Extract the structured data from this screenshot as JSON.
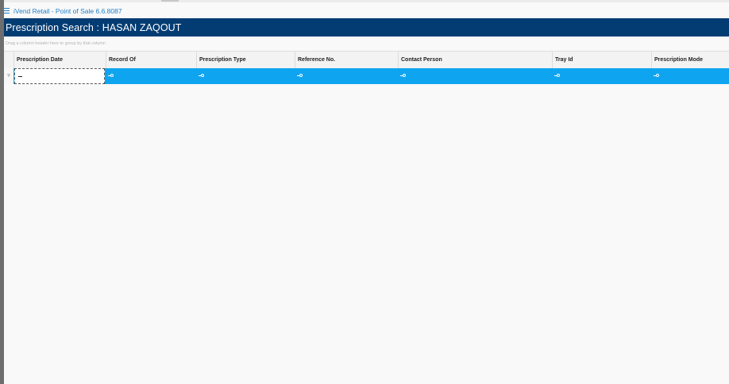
{
  "window": {
    "title": "iVend Retail - Point of Sale 6.6.8087",
    "icon": "menu-lines-icon"
  },
  "header": {
    "title": "Prescription Search : HASAN ZAQOUT",
    "background": "#033c73"
  },
  "grid": {
    "group_hint": "Drag a column header here to group by that column",
    "columns": [
      "Prescription Date",
      "Record Of",
      "Prescription Type",
      "Reference No.",
      "Contact Person",
      "Tray Id",
      "Prescription Mode"
    ],
    "filter_row": {
      "indicator": "▿",
      "first_cell_operator": "=",
      "cell_icon": "filter-operator-icon",
      "highlight_color": "#0fa4ef"
    }
  }
}
